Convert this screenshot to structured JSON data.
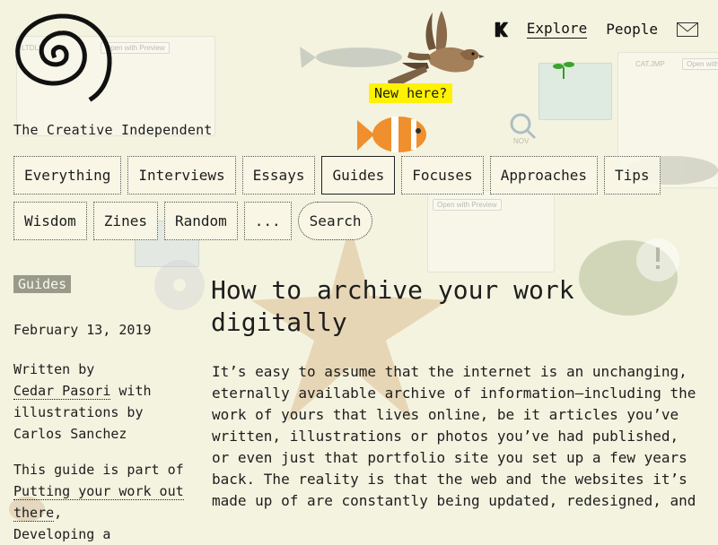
{
  "site": {
    "title": "The Creative Independent",
    "new_here_label": "New here?"
  },
  "top_nav": {
    "links": [
      {
        "label": "Explore",
        "active": true
      },
      {
        "label": "People",
        "active": false
      }
    ],
    "icons": [
      "kickstarter-icon",
      "mail-icon"
    ]
  },
  "tabs": {
    "row1": [
      {
        "label": "Everything"
      },
      {
        "label": "Interviews"
      },
      {
        "label": "Essays"
      },
      {
        "label": "Guides",
        "selected": true
      },
      {
        "label": "Focuses"
      },
      {
        "label": "Approaches"
      },
      {
        "label": "Tips"
      }
    ],
    "row2": [
      {
        "label": "Wisdom"
      },
      {
        "label": "Zines"
      },
      {
        "label": "Random"
      },
      {
        "label": "..."
      },
      {
        "label": "Search"
      }
    ]
  },
  "article": {
    "category": "Guides",
    "date": "February 13, 2019",
    "written_by": "Written by",
    "author": "Cedar Pasori",
    "illustrations_by": "with illustrations by",
    "illustrator": "Carlos Sanchez",
    "guide_part_prefix": "This guide is part of",
    "guide_link_1": "Putting your work out there",
    "guide_sep": ",",
    "guide_part_rest": "Developing a",
    "title": "How to archive your work digitally",
    "body": "It’s easy to assume that the internet is an unchanging, eternally available archive of information—including the work of yours that lives online, be it articles you’ve written, illustrations or photos you’ve had published, or even just that portfolio site you set up a few years back. The reality is that the web and the websites it’s made up of are constantly being updated, redesigned, and"
  },
  "background": {
    "window_button": "Open with Preview",
    "file_labels": [
      "LTDLF",
      "CAT.JMP",
      "NOV"
    ]
  },
  "colors": {
    "page_bg": "#f4f3e0",
    "highlight_yellow": "#fff200",
    "badge_gray": "#9a9a8a",
    "text": "#1d1d1d"
  }
}
